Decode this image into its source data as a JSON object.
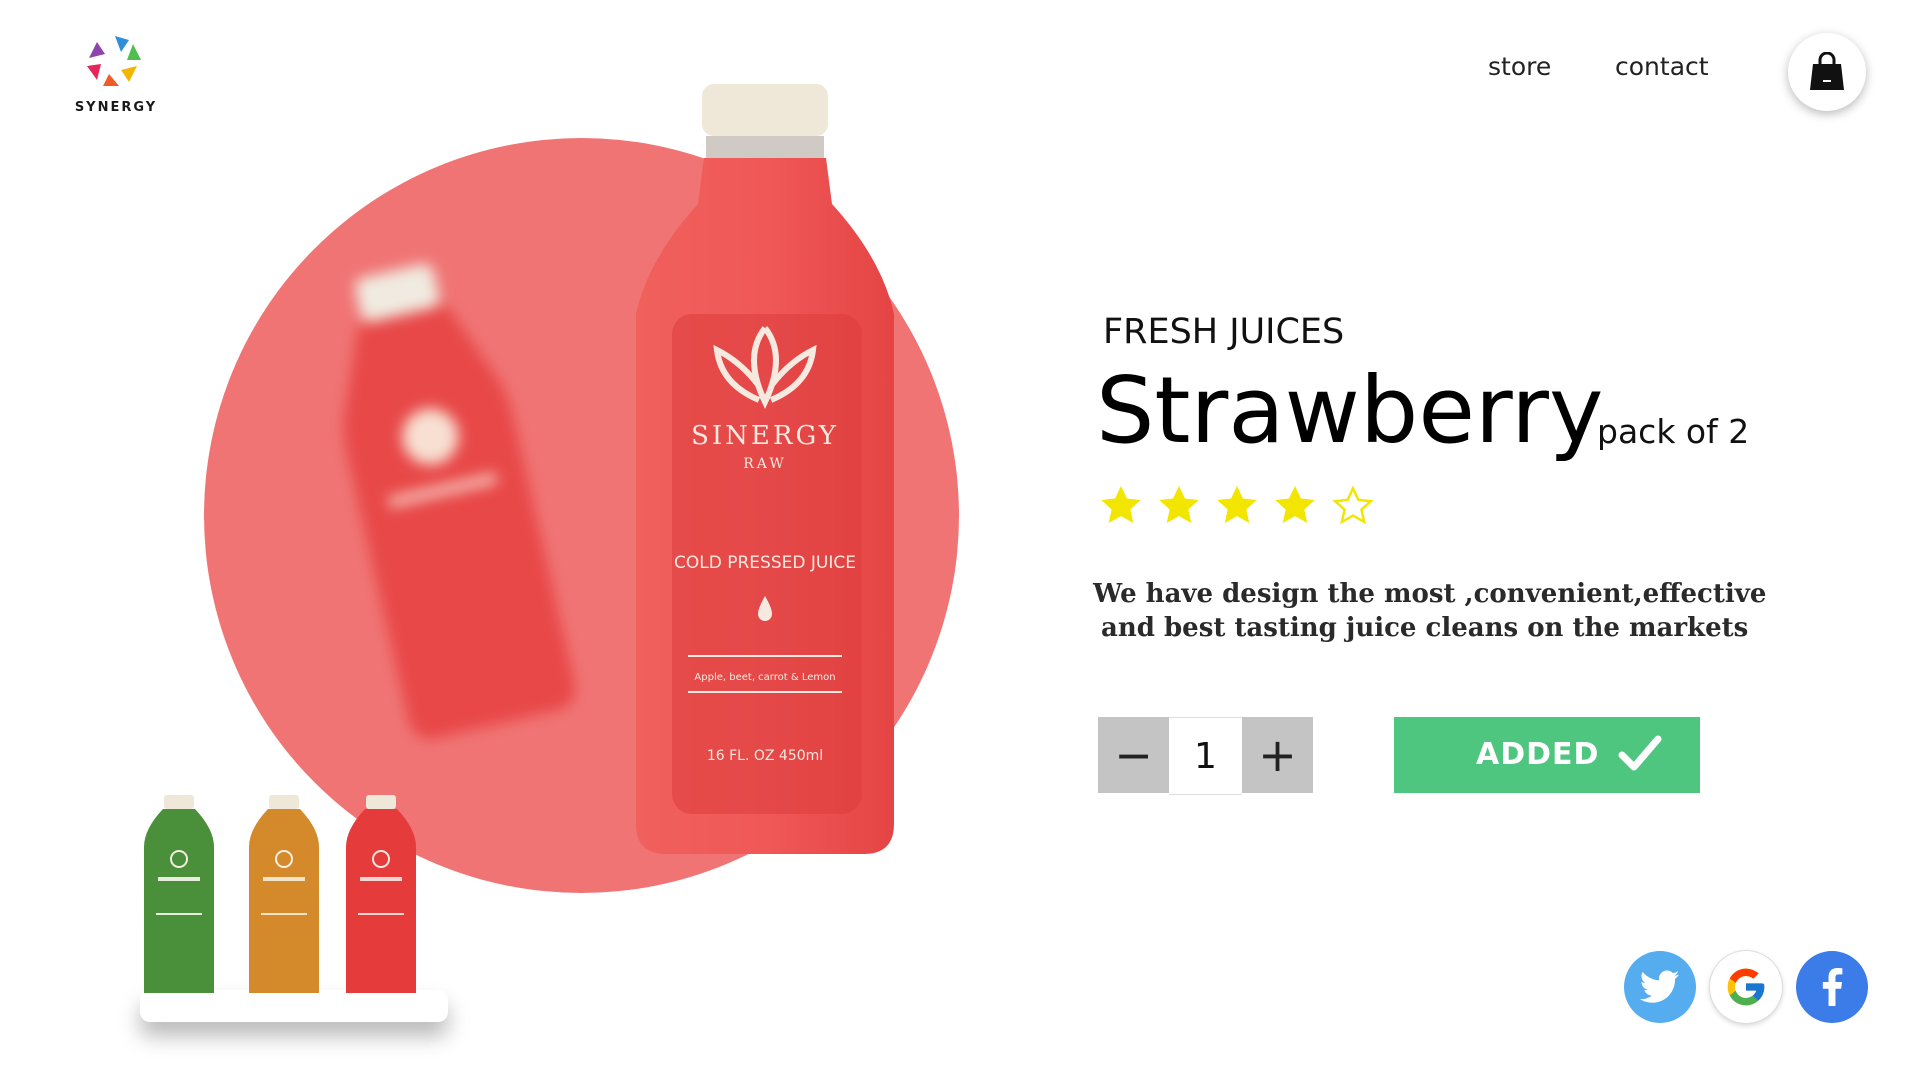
{
  "brand": {
    "logo_text": "SYNERGY"
  },
  "nav": {
    "store": "store",
    "contact": "contact"
  },
  "bottle": {
    "brand": "SINERGY",
    "sub": "RAW",
    "product": "COLD PRESSED JUICE",
    "ingredients": "Apple, beet, carrot & Lemon",
    "volume": "16 FL. OZ 450ml"
  },
  "product": {
    "category": "FRESH JUICES",
    "name": "Strawberry",
    "pack": "pack of 2",
    "rating": 4,
    "rating_max": 5,
    "description_line1": "We have design the most ,convenient,effective",
    "description_line2": "and best tasting juice cleans on the markets",
    "quantity": "1",
    "minus_label": "−",
    "plus_label": "+",
    "added_label": "ADDED"
  },
  "colors": {
    "accent_circle": "#f07474",
    "added_button": "#4fc67f",
    "star": "#f2e600",
    "thumb_green": "#4a8f3a",
    "thumb_orange": "#d48a2a",
    "thumb_red": "#e63b3b"
  },
  "icons": {
    "cart": "shopping-bag-icon",
    "twitter": "twitter-icon",
    "google": "google-icon",
    "facebook": "facebook-icon"
  }
}
